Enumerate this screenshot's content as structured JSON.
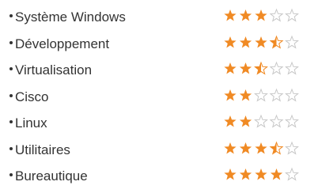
{
  "skills": [
    {
      "label": "Système Windows",
      "rating": 3,
      "max": 5
    },
    {
      "label": "Développement",
      "rating": 3.5,
      "max": 5
    },
    {
      "label": "Virtualisation",
      "rating": 2.5,
      "max": 5
    },
    {
      "label": "Cisco",
      "rating": 2,
      "max": 5
    },
    {
      "label": "Linux",
      "rating": 2,
      "max": 5
    },
    {
      "label": "Utilitaires",
      "rating": 3.5,
      "max": 5
    },
    {
      "label": "Bureautique",
      "rating": 4,
      "max": 5
    }
  ],
  "icons": {
    "bullet": "bullet-dot",
    "star": "star-icon"
  },
  "colors": {
    "text": "#333333",
    "star_fill": "#f08a24",
    "star_empty": "#c8c8c8"
  }
}
